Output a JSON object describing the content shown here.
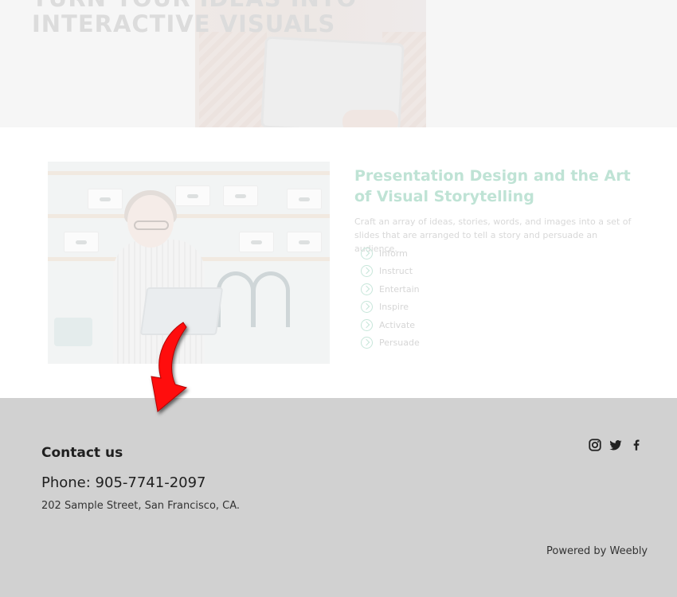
{
  "hero": {
    "title_line1": "TURN YOUR IDEAS INTO",
    "title_line2": "INTERACTIVE VISUALS"
  },
  "feature": {
    "title": "Presentation Design and the Art of Visual Storytelling",
    "description": "Craft an array of ideas, stories, words, and images into a set of slides that are arranged to tell a story and persuade an audience.",
    "items": [
      "Inform",
      "Instruct",
      "Entertain",
      "Inspire",
      "Activate",
      "Persuade"
    ],
    "accent_color": "#bfe3d5"
  },
  "arrow": {
    "color": "#ff0000",
    "icon": "curved-arrow-down-icon"
  },
  "footer": {
    "heading": "Contact us",
    "phone": "Phone: 905-7741-2097",
    "address": "202 Sample Street, San Francisco, CA.",
    "powered_by": "Powered by Weebly",
    "social_icons": [
      "instagram-icon",
      "twitter-icon",
      "facebook-icon"
    ],
    "background": "#d1d1d1"
  }
}
